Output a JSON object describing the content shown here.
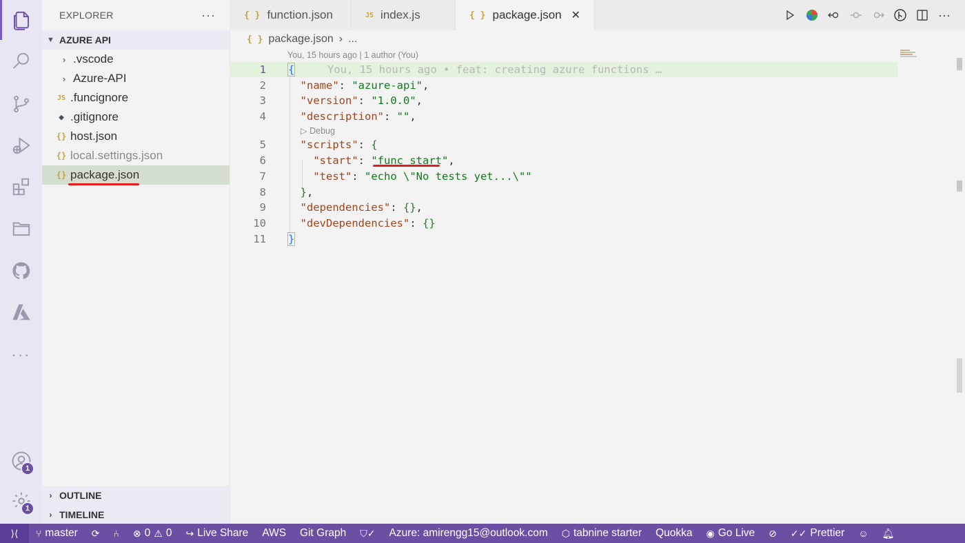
{
  "activity_bar": {
    "icons": [
      "explorer-icon",
      "search-icon",
      "source-control-icon",
      "run-debug-icon",
      "extensions-icon",
      "remote-explorer-icon",
      "github-icon",
      "azure-icon",
      "more-icon",
      "account-icon",
      "settings-gear-icon"
    ],
    "account_badge": "1",
    "settings_badge": "1",
    "more_label": "···"
  },
  "sidebar": {
    "title": "EXPLORER",
    "more": "···",
    "project": "AZURE API",
    "items": [
      {
        "label": ".vscode",
        "type": "folder"
      },
      {
        "label": "Azure-API",
        "type": "folder"
      },
      {
        "label": ".funcignore",
        "type": "js"
      },
      {
        "label": ".gitignore",
        "type": "git"
      },
      {
        "label": "host.json",
        "type": "json"
      },
      {
        "label": "local.settings.json",
        "type": "json"
      },
      {
        "label": "package.json",
        "type": "json"
      }
    ],
    "outline": "OUTLINE",
    "timeline": "TIMELINE"
  },
  "tabs": [
    {
      "label": "function.json",
      "icon": "{ }"
    },
    {
      "label": "index.js",
      "icon": "JS"
    },
    {
      "label": "package.json",
      "icon": "{ }",
      "close": "✕"
    }
  ],
  "breadcrumb": {
    "icon": "{ }",
    "file": "package.json",
    "sep": "›",
    "rest": "..."
  },
  "codelens": {
    "author": "You, 15 hours ago | 1 author (You)",
    "debug": "▷ Debug"
  },
  "code": {
    "line_numbers": [
      "1",
      "2",
      "3",
      "4",
      "5",
      "6",
      "7",
      "8",
      "9",
      "10",
      "11"
    ],
    "blame": "You, 15 hours ago • feat: creating azure functions …",
    "name_key": "\"name\"",
    "name_val": "\"azure-api\"",
    "version_key": "\"version\"",
    "version_val": "\"1.0.0\"",
    "description_key": "\"description\"",
    "description_val": "\"\"",
    "scripts_key": "\"scripts\"",
    "start_key": "\"start\"",
    "start_val": "func start",
    "test_key": "\"test\"",
    "test_val": "\"echo \\\"No tests yet...\\\"\"",
    "deps_key": "\"dependencies\"",
    "deps_val": "{}",
    "devdeps_key": "\"devDependencies\"",
    "devdeps_val": "{}"
  },
  "status_bar": {
    "branch": "master",
    "errors": "0",
    "warnings": "0",
    "live_share": "Live Share",
    "aws": "AWS",
    "git_graph": "Git Graph",
    "azure": "Azure: amirengg15@outlook.com",
    "tabnine": "tabnine starter",
    "quokka": "Quokka",
    "go_live": "Go Live",
    "prettier": "Prettier"
  }
}
